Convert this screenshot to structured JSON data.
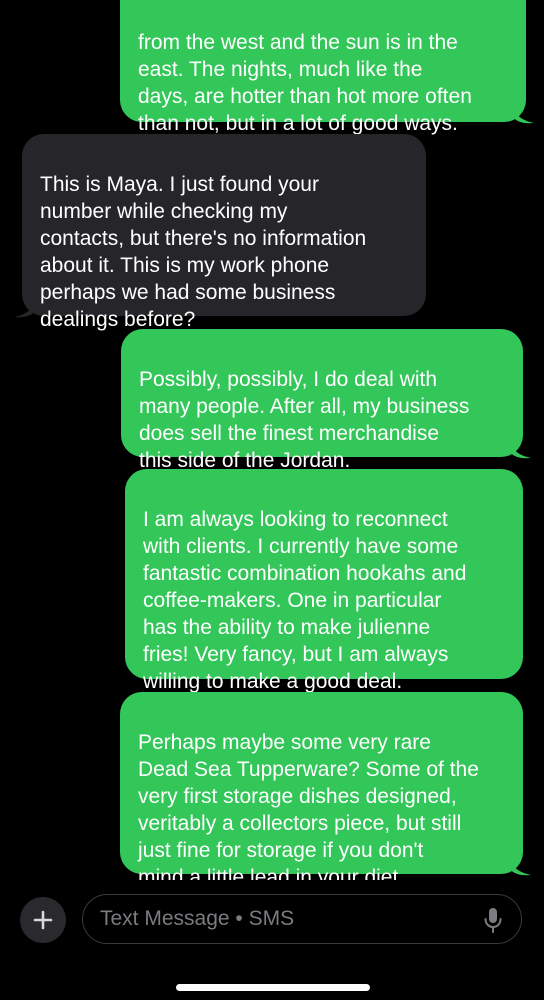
{
  "messages": [
    {
      "direction": "sent",
      "text": "from the west and the sun is in the\neast. The nights, much like the\ndays, are hotter than hot more often\nthan not, but in a lot of good ways."
    },
    {
      "direction": "received",
      "text": "This is Maya. I just found your\nnumber while checking my\ncontacts, but there's no information\nabout it. This is my work phone\nperhaps we had some business\ndealings before?"
    },
    {
      "direction": "sent",
      "text": "Possibly, possibly, I do deal with\nmany people. After all, my business\ndoes sell the finest merchandise\nthis side of the Jordan."
    },
    {
      "direction": "sent",
      "text": "I am always looking to reconnect\nwith clients. I currently have some\nfantastic combination hookahs and\ncoffee-makers. One in particular\nhas the ability to make julienne\nfries! Very fancy, but I am always\nwilling to make a good deal."
    },
    {
      "direction": "sent",
      "text": "Perhaps maybe some very rare\nDead Sea Tupperware? Some of the\nvery first storage dishes designed,\nveritably a collectors piece, but still\njust fine for storage if you don't\nmind a little lead in your diet."
    }
  ],
  "composer": {
    "placeholder": "Text Message • SMS",
    "value": ""
  },
  "icons": {
    "add": "plus-icon",
    "dictation": "microphone-icon"
  },
  "colors": {
    "background": "#000000",
    "sent_bubble": "#33c75a",
    "received_bubble": "#26262a",
    "placeholder": "#7b7b80"
  }
}
